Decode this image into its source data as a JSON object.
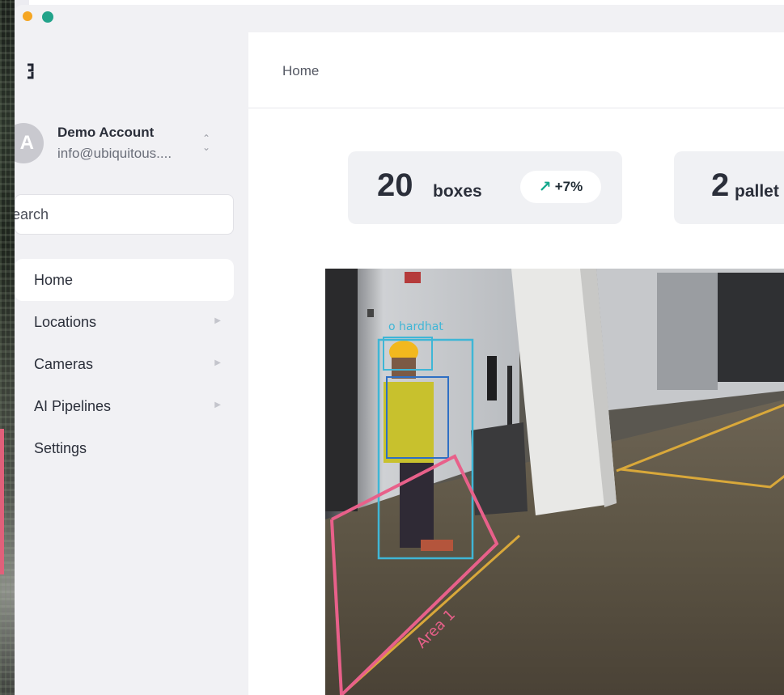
{
  "account": {
    "name": "Demo Account",
    "email": "info@ubiquitous....",
    "avatar_initial": "A"
  },
  "search": {
    "placeholder": "Search"
  },
  "nav": {
    "items": [
      {
        "label": "Home",
        "active": true,
        "has_submenu": false
      },
      {
        "label": "Locations",
        "active": false,
        "has_submenu": true
      },
      {
        "label": "Cameras",
        "active": false,
        "has_submenu": true
      },
      {
        "label": "AI Pipelines",
        "active": false,
        "has_submenu": true
      },
      {
        "label": "Settings",
        "active": false,
        "has_submenu": false
      }
    ]
  },
  "header": {
    "breadcrumb": "Home"
  },
  "stats": [
    {
      "value": "20",
      "unit": "boxes",
      "delta": "+7%",
      "delta_icon": "arrow-up-right-icon"
    },
    {
      "value": "2",
      "unit": "pallet"
    }
  ],
  "camera": {
    "detections": [
      {
        "label": "o hardhat"
      }
    ],
    "zones": [
      {
        "label": "Area 1",
        "color": "#e8608a"
      }
    ]
  },
  "colors": {
    "accent": "#13a88d",
    "zone": "#e8608a",
    "detection_box": "#3fb6d6",
    "person_box": "#2e6fc4"
  }
}
